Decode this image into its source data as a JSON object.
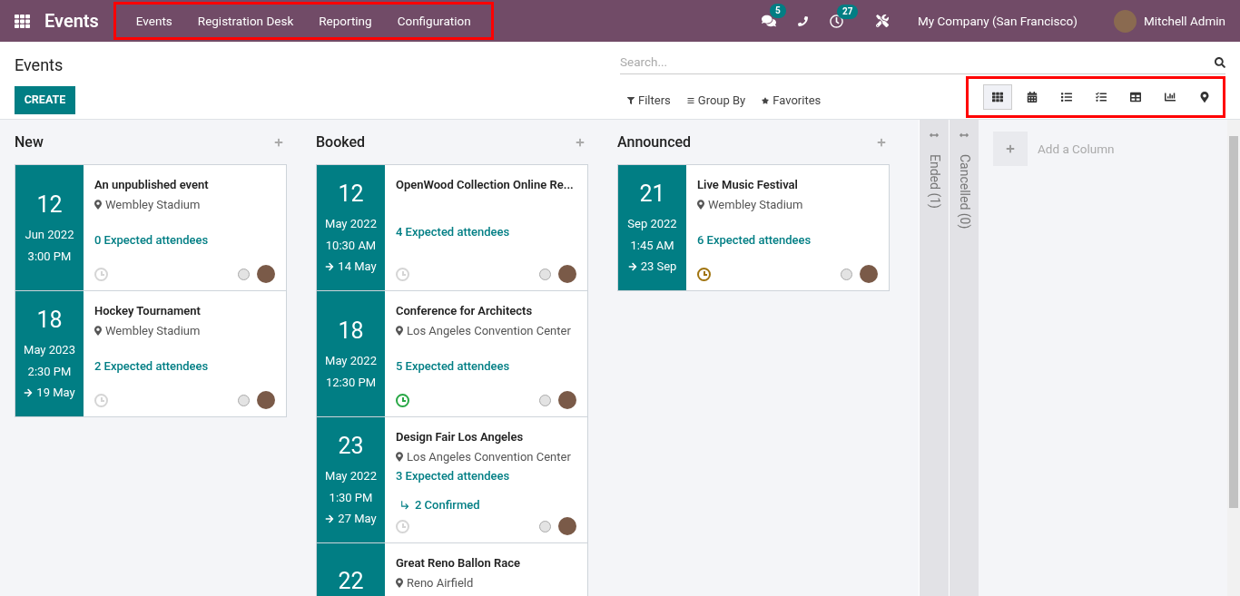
{
  "navbar": {
    "app_name": "Events",
    "menu": [
      "Events",
      "Registration Desk",
      "Reporting",
      "Configuration"
    ],
    "menu_highlighted": true,
    "messages_count": "5",
    "activities_count": "27",
    "company": "My Company (San Francisco)",
    "user": "Mitchell Admin"
  },
  "control_panel": {
    "title": "Events",
    "create_label": "CREATE",
    "search": {
      "placeholder": "Search..."
    },
    "filters": [
      {
        "kind": "filter",
        "label": "Filters"
      },
      {
        "kind": "group",
        "label": "Group By"
      },
      {
        "kind": "favorite",
        "label": "Favorites"
      }
    ],
    "views_highlighted": true,
    "views": [
      {
        "kind": "kanban",
        "selected": true
      },
      {
        "kind": "calendar",
        "selected": false
      },
      {
        "kind": "list",
        "selected": false
      },
      {
        "kind": "gantt",
        "selected": false
      },
      {
        "kind": "pivot",
        "selected": false
      },
      {
        "kind": "graph",
        "selected": false
      },
      {
        "kind": "map",
        "selected": false
      }
    ]
  },
  "columns": [
    {
      "title": "New",
      "folded": false,
      "cards": [
        {
          "day": "12",
          "month": "Jun 2022",
          "time": "3:00 PM",
          "name": "An unpublished event",
          "location": "Wembley Stadium",
          "attendees": "0 Expected attendees",
          "color": "#d5d5d5"
        },
        {
          "day": "18",
          "month": "May 2023",
          "time": "2:30 PM",
          "end": "19 May",
          "name": "Hockey Tournament",
          "location": "Wembley Stadium",
          "attendees": "2 Expected attendees",
          "color": "#d5d5d5"
        }
      ]
    },
    {
      "title": "Booked",
      "folded": false,
      "cards": [
        {
          "day": "12",
          "month": "May 2022",
          "time": "10:30 AM",
          "end": "14 May",
          "name": "OpenWood Collection Online Re...",
          "attendees": "4 Expected attendees",
          "color": "#d5d5d5"
        },
        {
          "day": "18",
          "month": "May 2022",
          "time": "12:30 PM",
          "name": "Conference for Architects",
          "location": "Los Angeles Convention Center",
          "attendees": "5 Expected attendees",
          "color": "#28a745"
        },
        {
          "day": "23",
          "month": "May 2022",
          "time": "1:30 PM",
          "end": "27 May",
          "name": "Design Fair Los Angeles",
          "location": "Los Angeles Convention Center",
          "attendees": "3 Expected attendees",
          "confirmed": "2 Confirmed",
          "color": "#d5d5d5"
        },
        {
          "day": "22",
          "name": "Great Reno Ballon Race",
          "location": "Reno Airfield"
        }
      ]
    },
    {
      "title": "Announced",
      "folded": false,
      "cards": [
        {
          "day": "21",
          "month": "Sep 2022",
          "time": "1:45 AM",
          "end": "23 Sep",
          "name": "Live Music Festival",
          "location": "Wembley Stadium",
          "attendees": "6 Expected attendees",
          "color": "#a0740f"
        }
      ]
    },
    {
      "title": "Ended (1)",
      "folded": true
    },
    {
      "title": "Cancelled (0)",
      "folded": true
    }
  ],
  "add_column_label": "Add a Column"
}
